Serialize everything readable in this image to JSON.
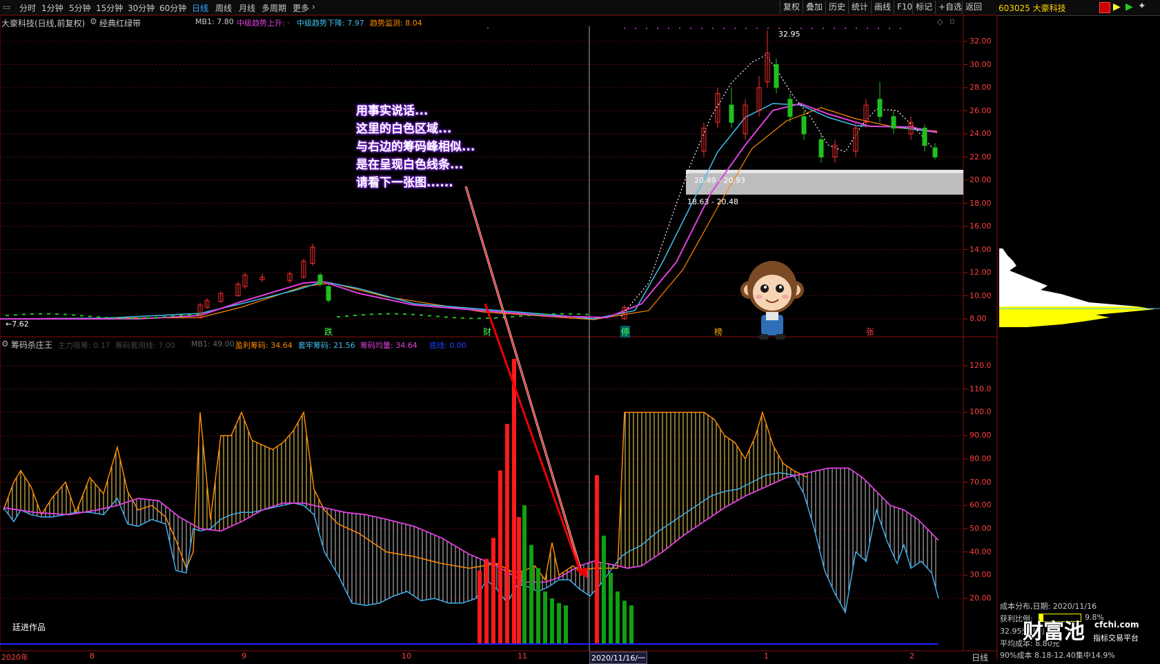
{
  "toolbar": {
    "periods": [
      "分时",
      "1分钟",
      "5分钟",
      "15分钟",
      "30分钟",
      "60分钟",
      "日线",
      "周线",
      "月线",
      "多周期",
      "更多"
    ],
    "active_period": "日线",
    "right_buttons": [
      "复权",
      "叠加",
      "历史",
      "统计",
      "画线",
      "F10",
      "标记",
      "+自选",
      "返回"
    ]
  },
  "stock": {
    "code_name": "603025 大豪科技"
  },
  "main_panel": {
    "title": "大豪科技(日线,前复权)",
    "indicator": "经典红绿带",
    "mb1": "MB1: 7.80",
    "up": "中级趋势上升: ·",
    "down": "中级趋势下降: 7.97",
    "monitor": "趋势监测: 8.04",
    "high_label": "32.95",
    "low_label": "7.62",
    "range1": "20.49 - 20.93",
    "range2": "18.63 - 20.48",
    "markers": [
      "跌",
      "财",
      "停",
      "榜",
      "张"
    ],
    "y_ticks": [
      "32.00",
      "30.00",
      "28.00",
      "26.00",
      "24.00",
      "22.00",
      "20.00",
      "18.00",
      "16.00",
      "14.00",
      "12.00",
      "10.00",
      "8.00"
    ]
  },
  "sub_panel": {
    "title": "筹码杀庄王",
    "main_force": "主力吸筹: 0.17",
    "heavy": "筹码套用线: 7.00",
    "mb1": "MB1: 49.00",
    "profit": "盈利筹码: 34.64",
    "trapped": "套牢筹码: 21.56",
    "avg": "筹码均量: 34.64",
    "base": "底线: 0.00",
    "watermark": "廷进作品",
    "y_ticks": [
      "120.0",
      "110.0",
      "100.0",
      "90.00",
      "80.00",
      "70.00",
      "60.00",
      "50.00",
      "40.00",
      "30.00",
      "20.00"
    ]
  },
  "x_axis": {
    "labels": [
      "2020年",
      "8",
      "9",
      "10",
      "11",
      "2020/11/16/一",
      "1",
      "2"
    ],
    "period": "日线"
  },
  "callout": {
    "lines": [
      "用事实说话...",
      "这里的白色区域...",
      "与右边的筹码峰相似...",
      "是在呈现白色线条...",
      "请看下一张图......"
    ]
  },
  "cost_panel": {
    "title": "成本分布,日期:  2020/11/16",
    "profit_ratio": "获利比例:",
    "profit_value": "9.8%",
    "line3": "32.95处获利",
    "avg_cost": "平均成本: 8.80元",
    "cost90": "90%成本 8.18-12.40集中14.9%"
  },
  "logo": {
    "brand": "财富池",
    "site": "cfchi.com",
    "tag": "指标交易平台"
  }
}
